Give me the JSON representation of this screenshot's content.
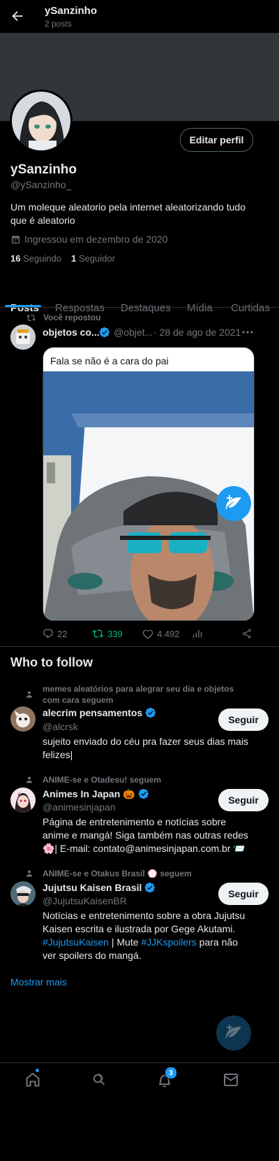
{
  "header": {
    "back_icon": "arrow-left-icon",
    "name": "ySanzinho",
    "posts_count": "2 posts"
  },
  "profile": {
    "edit_label": "Editar perfil",
    "display_name": "ySanzinho",
    "handle": "@ySanzinho_",
    "bio": "Um moleque aleatorio pela internet aleatorizando tudo que é aleatorio",
    "joined": "Ingressou em dezembro de 2020",
    "following_count": "16",
    "following_label": "Seguindo",
    "followers_count": "1",
    "followers_label": "Seguidor"
  },
  "tabs": [
    "Posts",
    "Respostas",
    "Destaques",
    "Mídia",
    "Curtidas"
  ],
  "post": {
    "repost_label": "Você repostou",
    "author_name": "objetos co...",
    "author_handle": "@objet...",
    "date": "· 28 de ago de 2021",
    "text": "Fala se não é a cara do pai",
    "replies": "22",
    "reposts": "339",
    "likes": "4.492"
  },
  "who_to_follow": {
    "title": "Who to follow",
    "items": [
      {
        "context": "memes aleatórios para alegrar seu dia e objetos com cara seguem",
        "name": "alecrim pensamentos",
        "handle": "@alcrsk",
        "follow_label": "Seguir",
        "bio": "sujeito enviado do céu pra fazer seus dias mais felizes|"
      },
      {
        "context": "ANIME-se e Otadesu! seguem",
        "name": "Animes In Japan 🎃",
        "handle": "@animesinjapan",
        "follow_label": "Seguir",
        "bio": "Página de entretenimento e notícias sobre anime e mangá! Siga também nas outras redes 🌸| E-mail: contato@animesinjapan.com.br 📨"
      },
      {
        "context": "ANIME-se e Otakus Brasil 💮 seguem",
        "name": "Jujutsu Kaisen Brasil",
        "handle": "@JujutsuKaisenBR",
        "follow_label": "Seguir",
        "bio_part1": "Notícias e entretenimento sobre a obra Jujutsu Kaisen escrita e ilustrada por Gege Akutami. ",
        "bio_tag1": "#JujutsuKaisen",
        "bio_part2": " | Mute ",
        "bio_tag2": "#JJKspoilers",
        "bio_part3": " para não ver spoilers do mangá."
      }
    ],
    "show_more": "Mostrar mais"
  },
  "bottom_nav": {
    "notification_badge": "3",
    "icons": [
      "home-icon",
      "search-icon",
      "bell-icon",
      "mail-icon"
    ]
  },
  "colors": {
    "accent": "#1d9bf0",
    "background": "#000000",
    "repost_green": "#00ba7c",
    "banner": "#333639"
  }
}
